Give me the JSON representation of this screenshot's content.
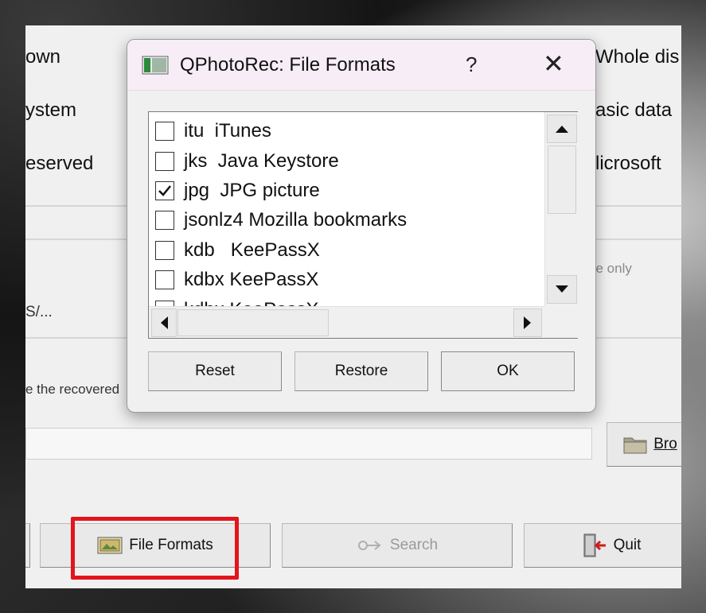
{
  "background": {
    "rows": [
      "own",
      "ystem",
      "eserved"
    ],
    "right_rows": [
      "Whole dis",
      "asic data",
      "licrosoft"
    ],
    "space_only": "ce only",
    "path_fragment": "S/...",
    "recovered_text": "e the recovered",
    "browse_label": "Bro"
  },
  "toolbar": {
    "file_formats_label": "File Formats",
    "search_label": "Search",
    "quit_label": "Quit"
  },
  "dialog": {
    "title": "QPhotoRec: File Formats",
    "help": "?",
    "close": "✕",
    "items": [
      {
        "label": "itu  iTunes",
        "checked": false
      },
      {
        "label": "jks  Java Keystore",
        "checked": false
      },
      {
        "label": "jpg  JPG picture",
        "checked": true
      },
      {
        "label": "jsonlz4 Mozilla bookmarks",
        "checked": false
      },
      {
        "label": "kdb   KeePassX",
        "checked": false
      },
      {
        "label": "kdbx KeePassX",
        "checked": false
      },
      {
        "label": "kdbx KeePassX",
        "checked": false
      }
    ],
    "buttons": {
      "reset": "Reset",
      "restore": "Restore",
      "ok": "OK"
    }
  },
  "colors": {
    "highlight": "#e3141c",
    "title_bar": "#f7edf6"
  }
}
